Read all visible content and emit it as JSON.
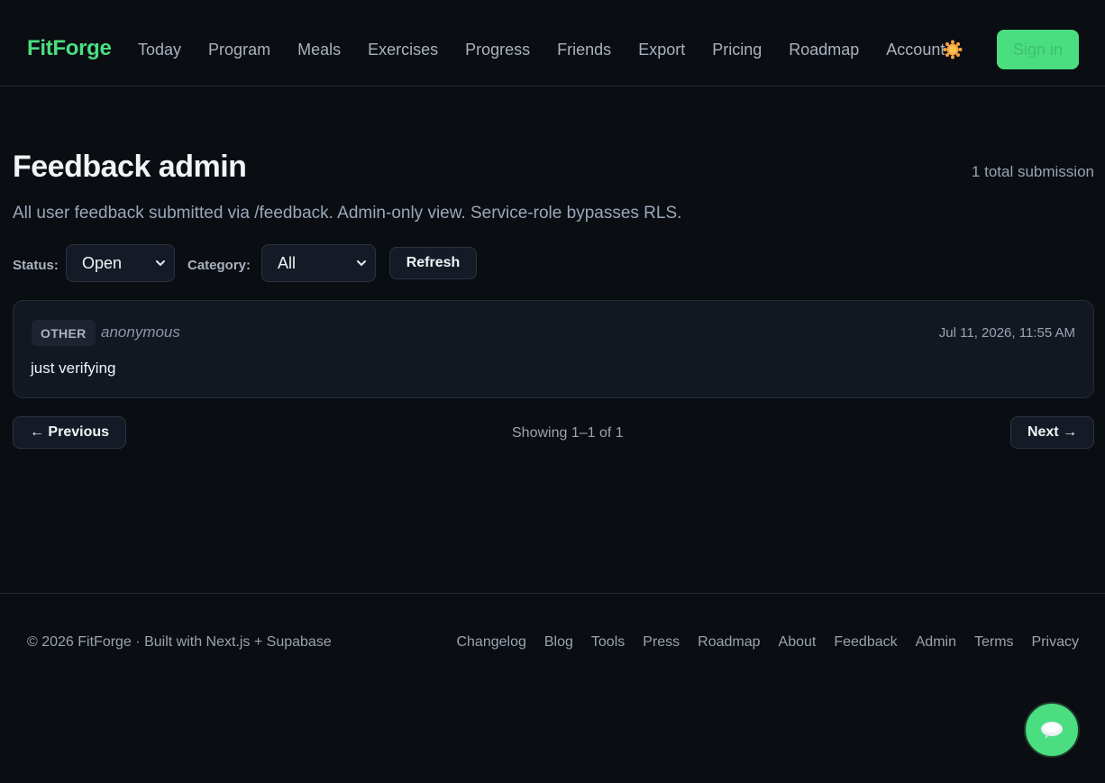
{
  "header": {
    "brand": "FitForge",
    "nav": [
      "Today",
      "Program",
      "Meals",
      "Exercises",
      "Progress",
      "Friends",
      "Export",
      "Pricing",
      "Roadmap",
      "Account"
    ],
    "theme_icon": "sun-icon",
    "signin_label": "Sign in"
  },
  "main": {
    "title": "Feedback admin",
    "total": "1 total submission",
    "subtitle": "All user feedback submitted via /feedback. Admin-only view. Service-role bypasses RLS.",
    "filters": {
      "status_label": "Status:",
      "status_value": "Open",
      "category_label": "Category:",
      "category_value": "All",
      "refresh_label": "Refresh"
    },
    "items": [
      {
        "category": "OTHER",
        "author": "anonymous",
        "date": "Jul 11, 2026, 11:55 AM",
        "message": "just verifying"
      }
    ],
    "pagination": {
      "prev_label": "← Previous",
      "showing": "Showing 1–1 of 1",
      "next_label": "Next →"
    }
  },
  "footer": {
    "copyright": "© 2026 FitForge · Built with Next.js + Supabase",
    "links": [
      "Changelog",
      "Blog",
      "Tools",
      "Press",
      "Roadmap",
      "About",
      "Feedback",
      "Admin",
      "Terms",
      "Privacy"
    ]
  },
  "fab": {
    "icon": "chat-bubble-icon"
  },
  "colors": {
    "accent": "#4ade80",
    "background": "#0a0d12",
    "card": "#121822"
  }
}
